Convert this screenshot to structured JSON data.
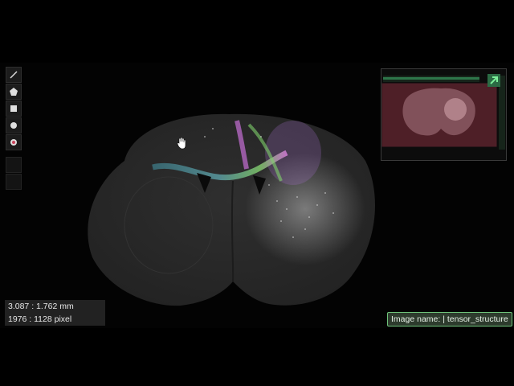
{
  "toolbar": {
    "tools": [
      {
        "icon": "line-icon"
      },
      {
        "icon": "pentagon-icon"
      },
      {
        "icon": "square-icon"
      },
      {
        "icon": "circle-icon"
      },
      {
        "icon": "point-icon"
      },
      {
        "icon": "blank-tool-icon"
      },
      {
        "icon": "blank-tool-icon"
      }
    ]
  },
  "navigator": {
    "expand_icon": "arrow-expand-icon",
    "accent_color": "#3fae6a",
    "viewport_color": "#c9435a"
  },
  "readout": {
    "mm": "3.087 : 1.762 mm",
    "pixel": "1976 : 1128 pixel"
  },
  "image_info": {
    "label": "Image name: | tensor_structure"
  },
  "colors": {
    "background": "#000000",
    "tissue": "#2a2a2a",
    "tag_border": "#6fc37a"
  }
}
